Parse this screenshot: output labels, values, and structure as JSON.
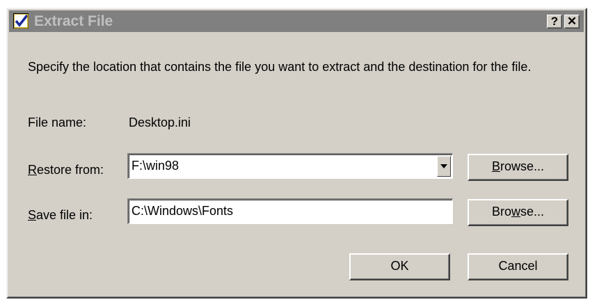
{
  "window": {
    "title": "Extract File",
    "help_label": "?",
    "close_label": "✕"
  },
  "description": "Specify the location that contains the file you want to extract and the destination for the file.",
  "file_name": {
    "label": "File name:",
    "value": "Desktop.ini"
  },
  "restore_from": {
    "label": "Restore from:",
    "value": "F:\\win98",
    "browse_label": "Browse..."
  },
  "save_file_in": {
    "label": "Save file in:",
    "value": "C:\\Windows\\Fonts",
    "browse_label": "Browse..."
  },
  "buttons": {
    "ok": "OK",
    "cancel": "Cancel"
  },
  "icons": {
    "app": "checkbox-icon",
    "dropdown": "chevron-down-icon"
  }
}
